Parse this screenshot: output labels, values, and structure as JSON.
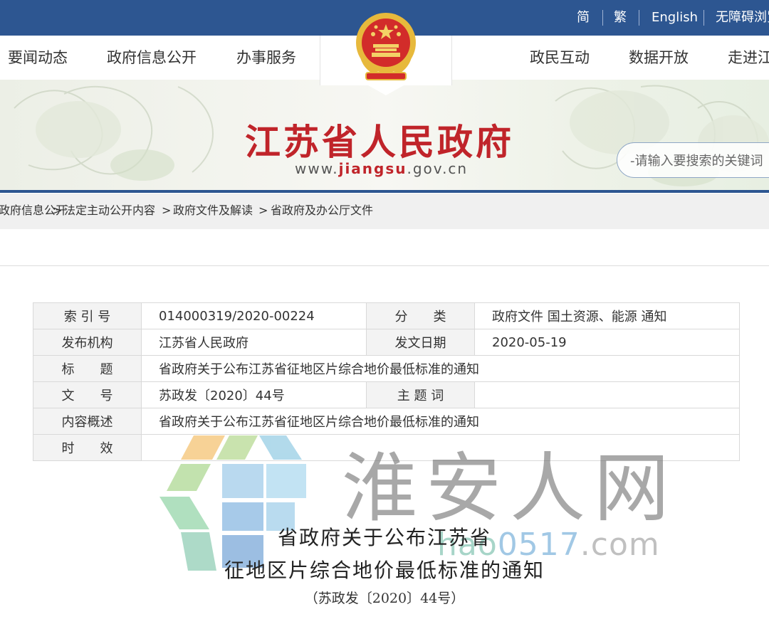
{
  "header": {
    "languages": [
      "简",
      "繁",
      "English",
      "无障碍浏览"
    ],
    "nav": [
      "要闻动态",
      "政府信息公开",
      "办事服务",
      "政民互动",
      "数据开放",
      "走进江苏"
    ],
    "emblem": "national-emblem-icon"
  },
  "banner": {
    "site_name": "江苏省人民政府",
    "url_prefix": "www.",
    "url_domain": "jiangsu",
    "url_suffix": ".gov.cn",
    "search_placeholder": "-请输入要搜索的关键词"
  },
  "breadcrumb": [
    "政府信息公开",
    "法定主动公开内容",
    "政府文件及解读",
    "省政府及办公厅文件"
  ],
  "info_table": {
    "rows": [
      [
        "索 引 号",
        "014000319/2020-00224",
        "分　　类",
        "政府文件 国土资源、能源 通知"
      ],
      [
        "发布机构",
        "江苏省人民政府",
        "发文日期",
        "2020-05-19"
      ],
      [
        "标　　题",
        "省政府关于公布江苏省征地区片综合地价最低标准的通知"
      ],
      [
        "文　　号",
        "苏政发〔2020〕44号",
        "主 题 词",
        ""
      ],
      [
        "内容概述",
        "省政府关于公布江苏省征地区片综合地价最低标准的通知"
      ],
      [
        "时　　效",
        ""
      ]
    ]
  },
  "watermark": {
    "text": "淮安人网",
    "sub_a": "hao",
    "sub_b": "0517",
    "sub_c": ".com"
  },
  "document": {
    "title_line1": "省政府关于公布江苏省",
    "title_line2": "征地区片综合地价最低标准的通知",
    "number": "（苏政发〔2020〕44号）"
  },
  "colors": {
    "primary_blue": "#2d5691",
    "title_red": "#c0242a",
    "emblem_gold": "#e7b93c"
  }
}
